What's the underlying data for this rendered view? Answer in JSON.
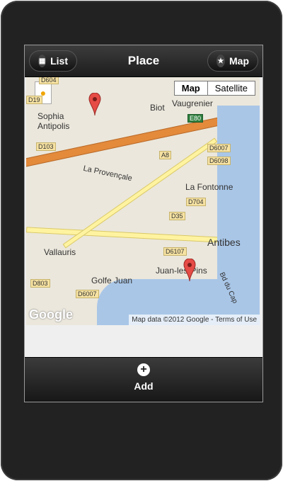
{
  "header": {
    "title": "Place",
    "left_button": {
      "label": "List",
      "icon": "grid-icon"
    },
    "right_button": {
      "label": "Map",
      "icon": "star-icon"
    }
  },
  "map": {
    "toggle": {
      "active": "Map",
      "inactive": "Satellite"
    },
    "attribution": "Map data ©2012 Google - Terms of Use",
    "logo": "Google",
    "labels": {
      "sophia": "Sophia Antipolis",
      "biot": "Biot",
      "vaugrenier": "Vaugrenier",
      "la_provencale": "La Provençale",
      "la_fontonne": "La Fontonne",
      "vallauris": "Vallauris",
      "antibes": "Antibes",
      "golfe_juan": "Golfe Juan",
      "juan_les_pins": "Juan-les-Pins",
      "bd_du_cap": "Bd du Cap"
    },
    "road_codes": {
      "d604": "D604",
      "d19": "D19",
      "d103": "D103",
      "a8": "A8",
      "e80": "E80",
      "d6007_top": "D6007",
      "d6098": "D6098",
      "d704": "D704",
      "d35": "D35",
      "d6107": "D6107",
      "d803": "D803",
      "d6007_bottom": "D6007"
    }
  },
  "footer": {
    "add_label": "Add",
    "add_icon": "plus-icon"
  }
}
